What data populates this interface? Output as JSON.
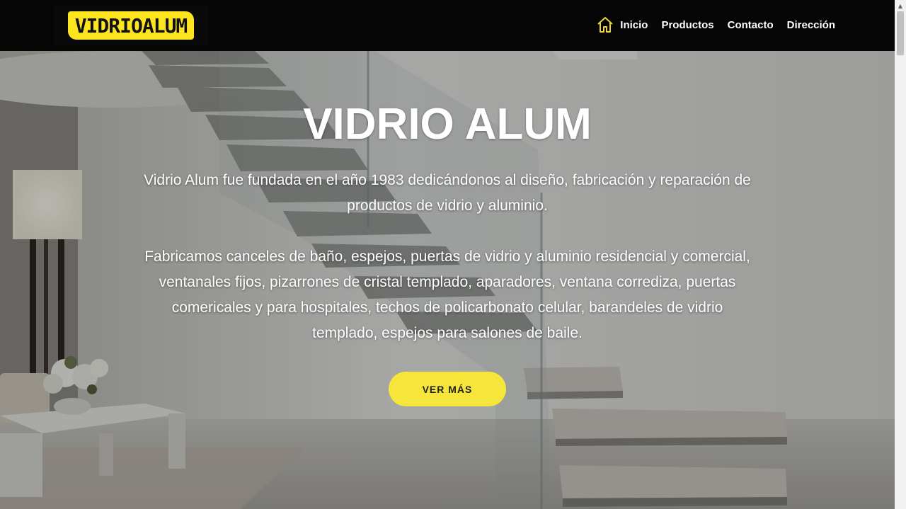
{
  "header": {
    "logo_text": "VIDRIOALUM",
    "nav": {
      "home_icon": "home-icon",
      "items": [
        {
          "label": "Inicio"
        },
        {
          "label": "Productos"
        },
        {
          "label": "Contacto"
        },
        {
          "label": "Dirección"
        }
      ]
    }
  },
  "hero": {
    "title": "VIDRIO ALUM",
    "paragraph1": "Vidrio Alum fue fundada en el año 1983 dedicándonos al diseño, fabricación y reparación de productos de vidrio y aluminio.",
    "paragraph2": "Fabricamos canceles de baño, espejos, puertas de vidrio y aluminio residencial y comercial, ventanales fijos, pizarrones de cristal templado, aparadores, ventana corrediza, puertas comericales y para hospitales, techos de policarbonato celular, barandeles de vidrio templado, espejos para salones de baile.",
    "button_label": "VER MÁS"
  },
  "colors": {
    "accent_yellow": "#fce51e",
    "header_bg": "#050505",
    "text_white": "#ffffff"
  }
}
